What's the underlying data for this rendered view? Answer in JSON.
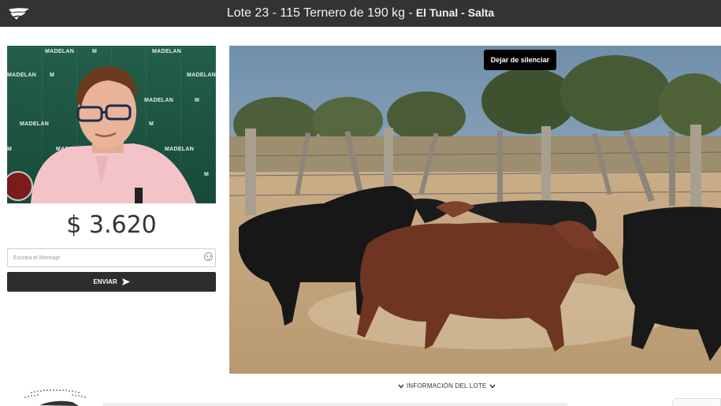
{
  "header": {
    "title": "Lote 23 - 115 Ternero de 190 kg -",
    "location": "El Tunal - Salta"
  },
  "left_panel": {
    "wall_brand": "MADELAN",
    "wall_monogram": "M",
    "price": "$ 3.620",
    "message_placeholder": "Escriba el Mensaje",
    "send_label": "ENVIAR"
  },
  "main_video": {
    "unmute_label": "Dejar de silenciar"
  },
  "footer": {
    "lot_info_label": "INFORMACIÓN DEL LOTE"
  },
  "colors": {
    "topbar": "#333333",
    "send_button": "#2e2e2e",
    "green_wall": "#1e5a45"
  },
  "icons": [
    "logo-icon",
    "emoji-icon",
    "send-arrow-icon",
    "chevron-down-icon"
  ]
}
